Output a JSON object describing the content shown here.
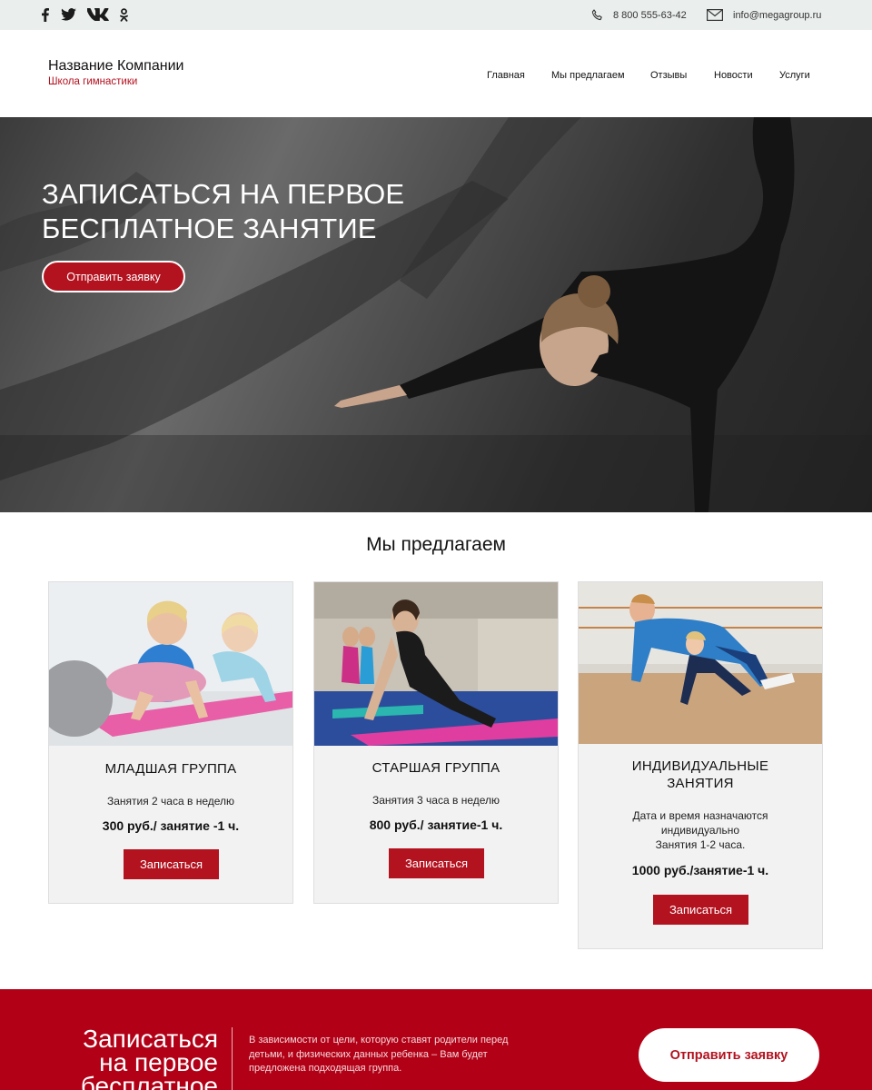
{
  "topbar": {
    "social": [
      "facebook-icon",
      "twitter-icon",
      "vk-icon",
      "odnoklassniki-icon"
    ],
    "phone": "8 800 555-63-42",
    "email": "info@megagroup.ru"
  },
  "header": {
    "company_name": "Название Компании",
    "tagline": "Школа гимнастики",
    "nav": [
      "Главная",
      "Мы предлагаем",
      "Отзывы",
      "Новости",
      "Услуги"
    ]
  },
  "hero": {
    "title": "ЗАПИСАТЬСЯ НА ПЕРВОЕ БЕСПЛАТНОЕ ЗАНЯТИЕ",
    "button": "Отправить заявку"
  },
  "offer": {
    "title": "Мы предлагаем",
    "cards": [
      {
        "title": "МЛАДШАЯ ГРУППА",
        "description": "Занятия 2 часа в неделю",
        "price": "300 руб./ занятие -1 ч.",
        "button": "Записаться"
      },
      {
        "title": "СТАРШАЯ ГРУППА",
        "description": "Занятия 3 часа в неделю",
        "price": "800 руб./ занятие-1 ч.",
        "button": "Записаться"
      },
      {
        "title_line1": "ИНДИВИДУАЛЬНЫЕ",
        "title_line2": "ЗАНЯТИЯ",
        "description_line1": "Дата и время назначаются",
        "description_line2": "индивидуально",
        "description_line3": "Занятия 1-2 часа.",
        "price": "1000 руб./занятие-1 ч.",
        "button": "Записаться"
      }
    ]
  },
  "cta": {
    "title_line1": "Записаться",
    "title_line2": "на первое",
    "title_line3": "бесплатное",
    "text_line1": "В зависимости от цели, которую ставят родители перед",
    "text_line2": "детьми, и физических данных ребенка – Вам будет",
    "text_line3": "предложена подходящая группа.",
    "button": "Отправить заявку"
  },
  "colors": {
    "accent": "#b3121f",
    "cta_background": "#b20016",
    "topbar_background": "#eaeeed",
    "card_background": "#f2f2f2"
  }
}
